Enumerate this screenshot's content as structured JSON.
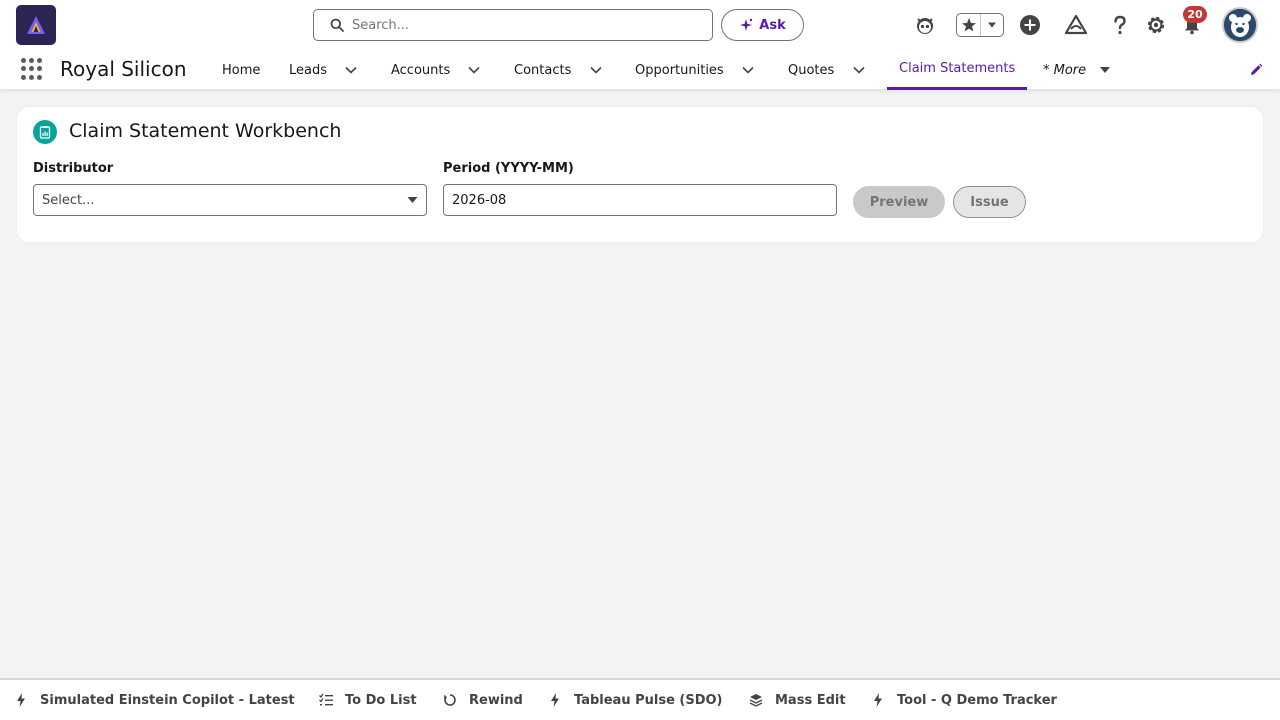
{
  "header": {
    "search_placeholder": "Search...",
    "ask_label": "Ask",
    "notification_count": "20"
  },
  "nav": {
    "app_name": "Royal Silicon",
    "items": [
      {
        "label": "Home"
      },
      {
        "label": "Leads"
      },
      {
        "label": "Accounts"
      },
      {
        "label": "Contacts"
      },
      {
        "label": "Opportunities"
      },
      {
        "label": "Quotes"
      },
      {
        "label": "Claim Statements"
      },
      {
        "label": "* More"
      }
    ],
    "active_item": "Claim Statements"
  },
  "card": {
    "title": "Claim Statement Workbench",
    "distributor_label": "Distributor",
    "distributor_value": "Select...",
    "period_label": "Period (YYYY-MM)",
    "period_value": "2026-08",
    "preview_label": "Preview",
    "issue_label": "Issue"
  },
  "utility_bar": {
    "items": [
      {
        "label": "Simulated Einstein Copilot - Latest",
        "icon": "bolt-icon"
      },
      {
        "label": "To Do List",
        "icon": "checklist-icon"
      },
      {
        "label": "Rewind",
        "icon": "refresh-icon"
      },
      {
        "label": "Tableau Pulse (SDO)",
        "icon": "bolt-icon"
      },
      {
        "label": "Mass Edit",
        "icon": "layers-icon"
      },
      {
        "label": "Tool - Q Demo Tracker",
        "icon": "bolt-icon"
      }
    ]
  },
  "colors": {
    "brand_accent": "#5a1ba9",
    "card_icon": "#06a59a",
    "badge": "#c23934",
    "logo_bg": "#2b2553"
  }
}
